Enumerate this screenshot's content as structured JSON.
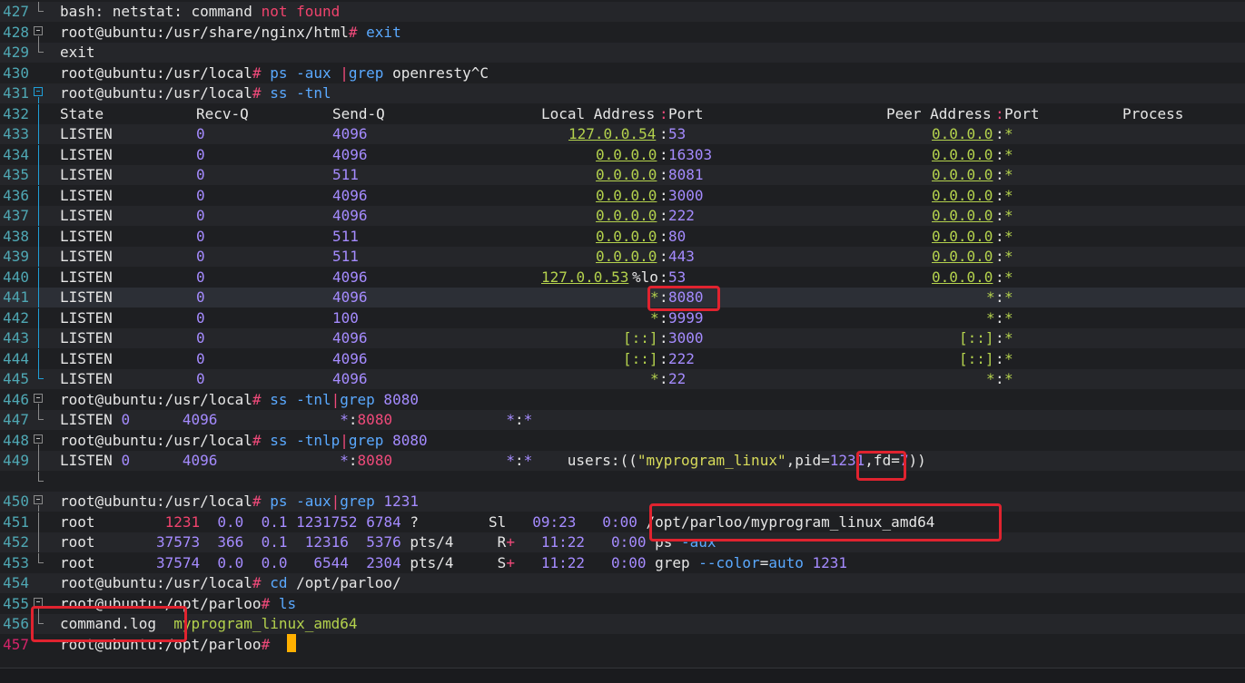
{
  "terminal": {
    "lines": [
      {
        "n": "427",
        "fold": "end",
        "segs": [
          [
            "wht",
            "bash: netstat: command "
          ],
          [
            "red",
            "not found"
          ]
        ]
      },
      {
        "n": "428",
        "fold": "box",
        "segs": [
          [
            "wht",
            "root@ubuntu:/usr/share/nginx/html"
          ],
          [
            "pink",
            "#"
          ],
          [
            "blu",
            " exit"
          ]
        ]
      },
      {
        "n": "429",
        "fold": "end",
        "segs": [
          [
            "wht",
            "exit"
          ]
        ]
      },
      {
        "n": "430",
        "fold": "",
        "segs": [
          [
            "wht",
            "root@ubuntu:/usr/local"
          ],
          [
            "pink",
            "#"
          ],
          [
            "blu",
            " ps -aux "
          ],
          [
            "pink",
            "|"
          ],
          [
            "blu",
            "grep"
          ],
          [
            "wht",
            " openresty^C"
          ]
        ]
      },
      {
        "n": "431",
        "fold": "boxblue",
        "segs": [
          [
            "wht",
            "root@ubuntu:/usr/local"
          ],
          [
            "pink",
            "#"
          ],
          [
            "blu",
            " ss -tnl"
          ]
        ]
      }
    ],
    "ss_header": {
      "n": "432",
      "state": "State",
      "recvq": "Recv-Q",
      "sendq": "Send-Q",
      "local": "Local Address",
      "port_sep": ":",
      "port": "Port",
      "peer": "Peer Address",
      "process": "Process"
    },
    "ss_rows": [
      {
        "n": "433",
        "state": "LISTEN",
        "recv": "0",
        "send": "4096",
        "laddr": "127.0.0.54",
        "lport": "53",
        "paddr": "0.0.0.0",
        "pport": "*"
      },
      {
        "n": "434",
        "state": "LISTEN",
        "recv": "0",
        "send": "4096",
        "laddr": "0.0.0.0",
        "lport": "16303",
        "paddr": "0.0.0.0",
        "pport": "*"
      },
      {
        "n": "435",
        "state": "LISTEN",
        "recv": "0",
        "send": "511",
        "laddr": "0.0.0.0",
        "lport": "8081",
        "paddr": "0.0.0.0",
        "pport": "*"
      },
      {
        "n": "436",
        "state": "LISTEN",
        "recv": "0",
        "send": "4096",
        "laddr": "0.0.0.0",
        "lport": "3000",
        "paddr": "0.0.0.0",
        "pport": "*"
      },
      {
        "n": "437",
        "state": "LISTEN",
        "recv": "0",
        "send": "4096",
        "laddr": "0.0.0.0",
        "lport": "222",
        "paddr": "0.0.0.0",
        "pport": "*"
      },
      {
        "n": "438",
        "state": "LISTEN",
        "recv": "0",
        "send": "511",
        "laddr": "0.0.0.0",
        "lport": "80",
        "paddr": "0.0.0.0",
        "pport": "*"
      },
      {
        "n": "439",
        "state": "LISTEN",
        "recv": "0",
        "send": "511",
        "laddr": "0.0.0.0",
        "lport": "443",
        "paddr": "0.0.0.0",
        "pport": "*"
      },
      {
        "n": "440",
        "state": "LISTEN",
        "recv": "0",
        "send": "4096",
        "laddr": "127.0.0.53",
        "lmid": "%lo",
        "lport": "53",
        "paddr": "0.0.0.0",
        "pport": "*"
      },
      {
        "n": "441",
        "state": "LISTEN",
        "recv": "0",
        "send": "4096",
        "laddr": "*",
        "lport": "8080",
        "paddr": "*",
        "pport": "*"
      },
      {
        "n": "442",
        "state": "LISTEN",
        "recv": "0",
        "send": "100",
        "laddr": "*",
        "lport": "9999",
        "paddr": "*",
        "pport": "*"
      },
      {
        "n": "443",
        "state": "LISTEN",
        "recv": "0",
        "send": "4096",
        "laddr": "[::]",
        "lport": "3000",
        "paddr": "[::]",
        "pport": "*"
      },
      {
        "n": "444",
        "state": "LISTEN",
        "recv": "0",
        "send": "4096",
        "laddr": "[::]",
        "lport": "222",
        "paddr": "[::]",
        "pport": "*"
      },
      {
        "n": "445",
        "state": "LISTEN",
        "recv": "0",
        "send": "4096",
        "laddr": "*",
        "lport": "22",
        "paddr": "*",
        "pport": "*"
      }
    ],
    "tail_lines": [
      {
        "n": "446",
        "fold": "box",
        "segs": [
          [
            "wht",
            "root@ubuntu:/usr/local"
          ],
          [
            "pink",
            "#"
          ],
          [
            "blu",
            " ss -tnl"
          ],
          [
            "pink",
            "|"
          ],
          [
            "blu",
            "grep"
          ],
          [
            "pur",
            " 8080"
          ]
        ]
      },
      {
        "n": "447",
        "fold": "end",
        "segs": [
          [
            "wht",
            "LISTEN "
          ],
          [
            "pur",
            "0"
          ],
          [
            "wht",
            "      "
          ],
          [
            "pur",
            "4096"
          ],
          [
            "wht",
            "              "
          ],
          [
            "pur",
            "*"
          ],
          [
            "wht",
            ":"
          ],
          [
            "pink",
            "8080"
          ],
          [
            "wht",
            "             "
          ],
          [
            "pur",
            "*"
          ],
          [
            "wht",
            ":"
          ],
          [
            "pur",
            "*"
          ]
        ]
      },
      {
        "n": "448",
        "fold": "box",
        "segs": [
          [
            "wht",
            "root@ubuntu:/usr/local"
          ],
          [
            "pink",
            "#"
          ],
          [
            "blu",
            " ss -tnlp"
          ],
          [
            "pink",
            "|"
          ],
          [
            "blu",
            "grep"
          ],
          [
            "pur",
            " 8080"
          ]
        ]
      },
      {
        "n": "449",
        "fold": "vline",
        "segs": [
          [
            "wht",
            "LISTEN "
          ],
          [
            "pur",
            "0"
          ],
          [
            "wht",
            "      "
          ],
          [
            "pur",
            "4096"
          ],
          [
            "wht",
            "              "
          ],
          [
            "pur",
            "*"
          ],
          [
            "wht",
            ":"
          ],
          [
            "pink",
            "8080"
          ],
          [
            "wht",
            "             "
          ],
          [
            "pur",
            "*"
          ],
          [
            "wht",
            ":"
          ],
          [
            "pur",
            "*"
          ],
          [
            "wht",
            "    users:(("
          ],
          [
            "yel",
            "\"myprogram_linux\""
          ],
          [
            "wht",
            ",pid="
          ],
          [
            "pur",
            "1231"
          ],
          [
            "wht",
            ",fd="
          ],
          [
            "pur",
            "7"
          ],
          [
            "wht",
            "))"
          ]
        ]
      },
      {
        "n": "",
        "fold": "end",
        "segs": []
      },
      {
        "n": "450",
        "fold": "box",
        "segs": [
          [
            "wht",
            "root@ubuntu:/usr/local"
          ],
          [
            "pink",
            "#"
          ],
          [
            "blu",
            " ps -aux"
          ],
          [
            "pink",
            "|"
          ],
          [
            "blu",
            "grep"
          ],
          [
            "pur",
            " 1231"
          ]
        ]
      },
      {
        "n": "451",
        "fold": "vline",
        "segs": [
          [
            "wht",
            "root        "
          ],
          [
            "red",
            "1231"
          ],
          [
            "wht",
            "  "
          ],
          [
            "pur",
            "0.0"
          ],
          [
            "wht",
            "  "
          ],
          [
            "pur",
            "0.1"
          ],
          [
            "wht",
            " "
          ],
          [
            "pur",
            "1231752"
          ],
          [
            "wht",
            " "
          ],
          [
            "pur",
            "6784"
          ],
          [
            "wht",
            " ?        Sl   "
          ],
          [
            "pur",
            "09:23"
          ],
          [
            "wht",
            "   "
          ],
          [
            "pur",
            "0:00"
          ],
          [
            "wht",
            " /opt/parloo/myprogram_linux_amd64"
          ]
        ]
      },
      {
        "n": "452",
        "fold": "vline",
        "segs": [
          [
            "wht",
            "root       "
          ],
          [
            "pur",
            "37573"
          ],
          [
            "wht",
            "  "
          ],
          [
            "pur",
            "366"
          ],
          [
            "wht",
            "  "
          ],
          [
            "pur",
            "0.1"
          ],
          [
            "wht",
            "  "
          ],
          [
            "pur",
            "12316"
          ],
          [
            "wht",
            "  "
          ],
          [
            "pur",
            "5376"
          ],
          [
            "wht",
            " pts/4     R"
          ],
          [
            "pink",
            "+"
          ],
          [
            "wht",
            "   "
          ],
          [
            "pur",
            "11:22"
          ],
          [
            "wht",
            "   "
          ],
          [
            "pur",
            "0:00"
          ],
          [
            "wht",
            " ps "
          ],
          [
            "blu",
            "-aux"
          ]
        ]
      },
      {
        "n": "453",
        "fold": "end",
        "segs": [
          [
            "wht",
            "root       "
          ],
          [
            "pur",
            "37574"
          ],
          [
            "wht",
            "  "
          ],
          [
            "pur",
            "0.0"
          ],
          [
            "wht",
            "  "
          ],
          [
            "pur",
            "0.0"
          ],
          [
            "wht",
            "   "
          ],
          [
            "pur",
            "6544"
          ],
          [
            "wht",
            "  "
          ],
          [
            "pur",
            "2304"
          ],
          [
            "wht",
            " pts/4     S"
          ],
          [
            "pink",
            "+"
          ],
          [
            "wht",
            "   "
          ],
          [
            "pur",
            "11:22"
          ],
          [
            "wht",
            "   "
          ],
          [
            "pur",
            "0:00"
          ],
          [
            "wht",
            " grep "
          ],
          [
            "blu",
            "--color"
          ],
          [
            "wht",
            "="
          ],
          [
            "blu",
            "auto"
          ],
          [
            "pur",
            " 1231"
          ]
        ]
      },
      {
        "n": "454",
        "fold": "",
        "segs": [
          [
            "wht",
            "root@ubuntu:/usr/local"
          ],
          [
            "pink",
            "#"
          ],
          [
            "blu",
            " cd"
          ],
          [
            "wht",
            " /opt/parloo/"
          ]
        ]
      },
      {
        "n": "455",
        "fold": "box",
        "segs": [
          [
            "wht",
            "root@ubuntu:/opt/parloo"
          ],
          [
            "pink",
            "#"
          ],
          [
            "blu",
            " ls"
          ]
        ]
      },
      {
        "n": "456",
        "fold": "end",
        "segs": [
          [
            "wht",
            "command.log  "
          ],
          [
            "grn",
            "myprogram_linux_amd64"
          ]
        ]
      },
      {
        "n": "457",
        "fold": "",
        "active": true,
        "segs": [
          [
            "wht",
            "root@ubuntu:/opt/parloo"
          ],
          [
            "pink",
            "#"
          ],
          [
            "wht",
            " "
          ]
        ]
      }
    ]
  },
  "colors": {
    "background": "#1e1f22",
    "line_number": "#4fa8b4",
    "active_line_number": "#d6246a",
    "cursor": "#ffb000",
    "highlight_box": "#e0232f"
  }
}
